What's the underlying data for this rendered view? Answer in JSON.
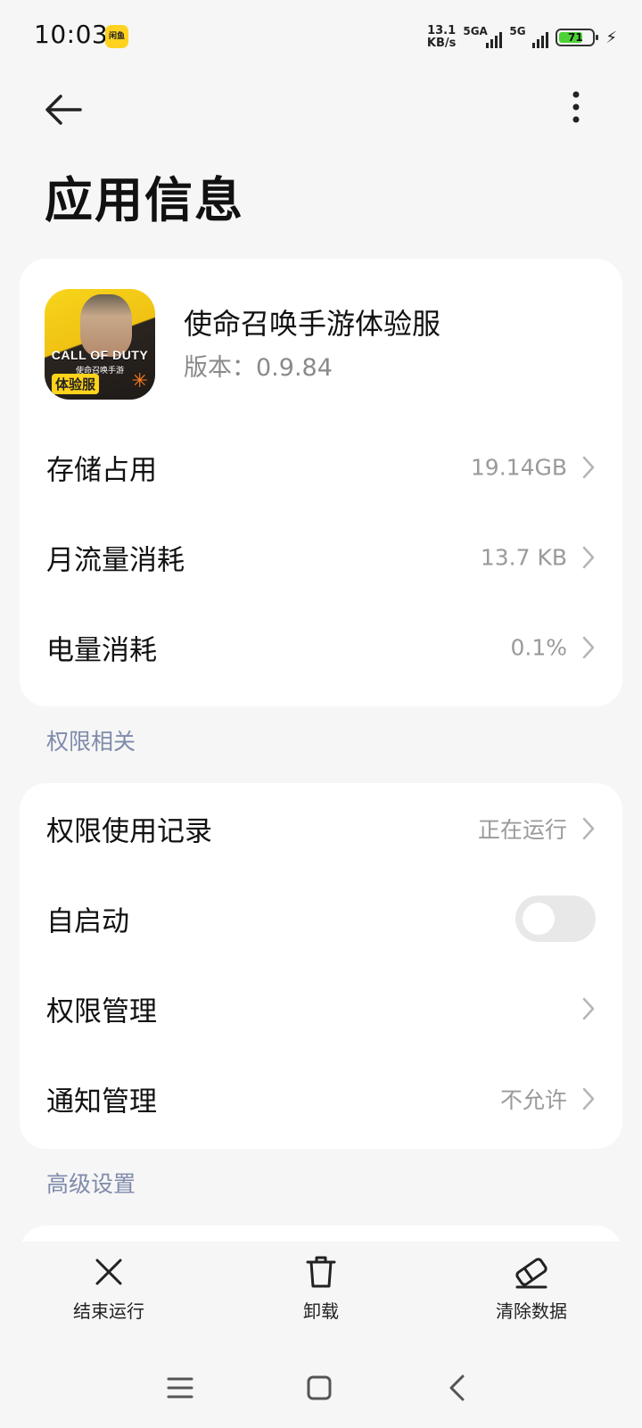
{
  "status_bar": {
    "time": "10:03",
    "app_badge": "闲鱼",
    "net_speed_value": "13.1",
    "net_speed_unit": "KB/s",
    "signal1_label": "5GA",
    "signal2_label": "5G",
    "battery": "71",
    "battery_level": 0.71,
    "battery_color": "#4cd237"
  },
  "header": {
    "back_icon": "arrow-left-icon",
    "more_icon": "more-vertical-icon",
    "title": "应用信息"
  },
  "app": {
    "name": "使命召唤手游体验服",
    "version": "版本：0.9.84",
    "icon_text_main": "CALL OF DUTY",
    "icon_text_sub": "使命召唤手游",
    "icon_tag": "体验服"
  },
  "usage_rows": [
    {
      "label": "存储占用",
      "value": "19.14GB"
    },
    {
      "label": "月流量消耗",
      "value": "13.7 KB"
    },
    {
      "label": "电量消耗",
      "value": "0.1%"
    }
  ],
  "permission_section": {
    "title": "权限相关",
    "rows": [
      {
        "label": "权限使用记录",
        "value": "正在运行"
      },
      {
        "label": "自启动",
        "toggle_on": false
      },
      {
        "label": "权限管理",
        "value": ""
      },
      {
        "label": "通知管理",
        "value": "不允许"
      }
    ]
  },
  "advanced_section": {
    "title": "高级设置"
  },
  "actions": [
    {
      "label": "结束运行",
      "icon": "close-icon"
    },
    {
      "label": "卸载",
      "icon": "trash-icon"
    },
    {
      "label": "清除数据",
      "icon": "eraser-icon"
    }
  ],
  "nav": {
    "menu_icon": "menu-icon",
    "home_icon": "home-square-icon",
    "back_icon": "chevron-left-icon"
  },
  "colors": {
    "background": "#f6f6f6",
    "card": "#ffffff",
    "section_label": "#7f8bab",
    "secondary_text": "#9a9a9a"
  }
}
